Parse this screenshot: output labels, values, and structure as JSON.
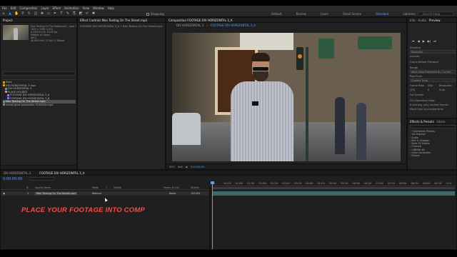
{
  "menu": [
    "File",
    "Edit",
    "Composition",
    "Layer",
    "Effect",
    "Animation",
    "View",
    "Window",
    "Help"
  ],
  "toolbar": {
    "snapping_label": "Snapping",
    "workspaces": [
      "Default",
      "Review",
      "Learn",
      "Small Screen",
      "Standard",
      "Libraries"
    ],
    "active_workspace": "Standard",
    "search_placeholder": "Search Help"
  },
  "project_panel": {
    "tab": "Project",
    "clip_name": "Man Texting On The Street.mp4 , used 1 time",
    "details": [
      "1920 x 1080 (1.00)",
      "Δ 0:00:21:04, 25.00 fps",
      "Millions of Colors",
      "AVC1",
      "48.000 kHz / 32 bit U / Stereo"
    ],
    "items": [
      {
        "label": "Slots",
        "type": "folder"
      },
      {
        "label": "DIV HORIZONTAL 3 mov",
        "type": "folder"
      },
      {
        "label": "DIV HORIZONTAL 3",
        "type": "comp"
      },
      {
        "label": "PLACE HOLDER",
        "type": "folder"
      },
      {
        "label": "FOOTAGE DIV HORIZONTAL 3_A",
        "type": "comp"
      },
      {
        "label": "FOOTAGE DIV HORIZONTAL 3_B",
        "type": "comp"
      },
      {
        "label": "Man Texting On The Street.mp4",
        "type": "clip"
      },
      {
        "label": "reveal grow production 5135054.mp4",
        "type": "clip"
      }
    ]
  },
  "effect_controls": {
    "tab": "Effect Controls  Man Texting On The Street.mp4",
    "header": "FOOTAGE DIV HORIZONTAL 3_A • Man Texting On The Street.mp4"
  },
  "composition": {
    "tab": "Composition  FOOTAGE DIV HORIZONTAL 3_A",
    "sub_tabs": [
      "DIV HORIZONTAL 3",
      "FOOTAGE DIV HORIZONTAL 3_A"
    ],
    "active_sub_tab": "FOOTAGE DIV HORIZONTAL 3_A",
    "zoom": "50%",
    "resolution": "Half",
    "timecode": "0;00;00;00"
  },
  "preview_panel": {
    "tabs": [
      "Info",
      "Audio",
      "Preview"
    ],
    "shortcut_label": "Shortcut",
    "shortcut_value": "Spacebar",
    "include_label": "Include:",
    "cache_label": "Cache Before Playback",
    "range_label": "Range",
    "range_value": "Work Area Extended By Current",
    "play_from_label": "Play From",
    "play_from_value": "Current Time",
    "frame_rate_label": "Frame Rate",
    "skip_label": "Skip",
    "resolution_label": "Resolution",
    "frame_rate_value": "(25)",
    "skip_value": "0",
    "resolution_value": "Auto",
    "full_screen_label": "Full Screen",
    "on_stop_label": "On (Spacebar) Stop:",
    "if_caching_label": "If caching, play cached frames",
    "move_time_label": "Move time to preview time"
  },
  "effects_panel": {
    "tabs": [
      "Effects & Presets",
      "Librar"
    ],
    "items": [
      "* Animation Presets",
      "3D Channel",
      "Audio",
      "Blur & Sharpen",
      "Boris FX Mocha",
      "Channel",
      "CINEMA 4D",
      "Color Correction",
      "Distort"
    ]
  },
  "timeline": {
    "tabs": [
      "DIV HORIZONTAL 3",
      "FOOTAGE DIV HORIZONTAL 3_A"
    ],
    "active_tab": "FOOTAGE DIV HORIZONTAL 3_A",
    "timecode": "0;00;00;00",
    "columns": [
      "#",
      "Source Name",
      "Mode",
      "T",
      "TrkMat",
      "Parent & Link",
      "Stretch"
    ],
    "layer": {
      "index": "1",
      "name": "Man Texting On The Street.mp4",
      "mode": "Normal",
      "parent": "None",
      "stretch": "100.0%"
    },
    "ruler": [
      "0s",
      "00:15f",
      "01:00f",
      "01:15f",
      "02:00f",
      "02:15f",
      "03:00f",
      "03:15f",
      "04:00f",
      "04:15f",
      "05:00f",
      "05:15f",
      "06:00f",
      "06:15f",
      "07:00f",
      "07:15f",
      "08:00f",
      "08:15f",
      "09:00f",
      "09:15f",
      "10:0"
    ]
  },
  "overlay_caption": "PLACE YOUR FOOTAGE INTO COMP"
}
